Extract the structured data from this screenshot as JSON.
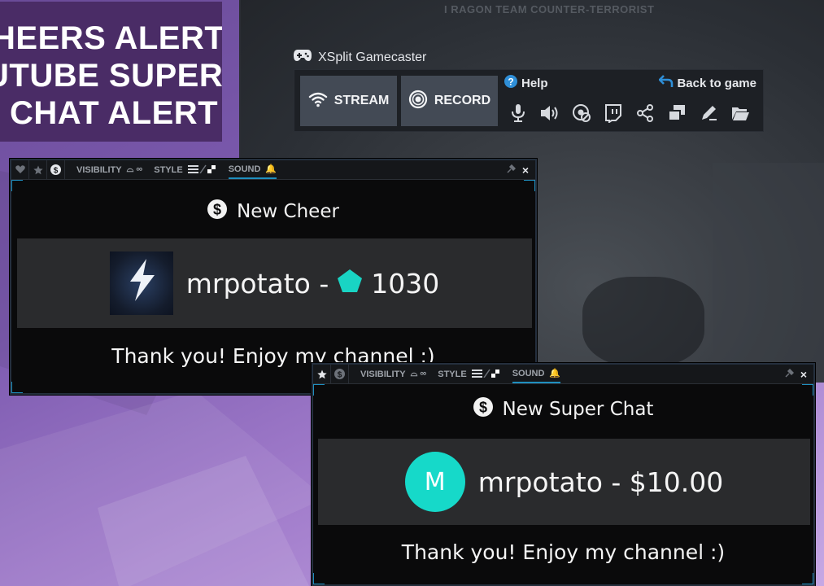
{
  "title_block": {
    "line1": "HEERS ALERT",
    "line2": "UTUBE SUPER",
    "line3": "CHAT ALERT",
    "bg": "#4a2c66"
  },
  "game": {
    "hud_text": "I  RAGON TEAM COUNTER-TERRORIST"
  },
  "gamecaster": {
    "title": "XSplit Gamecaster",
    "stream_label": "STREAM",
    "record_label": "RECORD",
    "help_label": "Help",
    "back_label": "Back to game",
    "icons": [
      "microphone-icon",
      "speaker-icon",
      "webcam-icon",
      "twitch-icon",
      "share-icon",
      "copy-windows-icon",
      "pen-icon",
      "folder-icon"
    ]
  },
  "cheer_alert": {
    "toolbar": {
      "visibility_label": "VISIBILITY",
      "style_label": "STYLE",
      "sound_label": "SOUND",
      "close": "×"
    },
    "header": "New Cheer",
    "user": "mrpotato -",
    "amount": "1030",
    "message": "Thank you! Enjoy my channel :)",
    "gem_color": "#19d4c4"
  },
  "super_chat_alert": {
    "toolbar": {
      "visibility_label": "VISIBILITY",
      "style_label": "STYLE",
      "sound_label": "SOUND",
      "close": "×"
    },
    "header": "New Super Chat",
    "avatar_letter": "M",
    "user_amount": "mrpotato - $10.00",
    "message": "Thank you! Enjoy my channel :)",
    "avatar_color": "#16d9c9"
  },
  "colors": {
    "accent_blue": "#1f8fbf",
    "button_bg": "#434a55",
    "panel_bg": "#1d2025"
  }
}
